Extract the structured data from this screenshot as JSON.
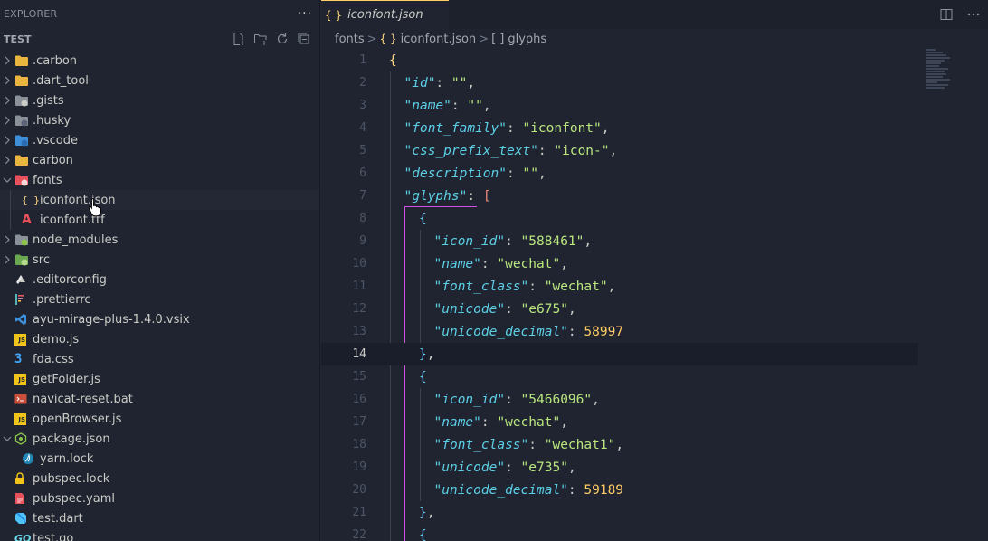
{
  "sidebar": {
    "title": "EXPLORER",
    "more": "···",
    "section": "TEST",
    "tree": [
      {
        "label": ".carbon",
        "icon": "folder-icon",
        "chevron": ">",
        "indent": 0
      },
      {
        "label": ".dart_tool",
        "icon": "folder-icon",
        "chevron": ">",
        "indent": 0
      },
      {
        "label": ".gists",
        "icon": "github-folder-icon",
        "chevron": ">",
        "indent": 0
      },
      {
        "label": ".husky",
        "icon": "husky-folder-icon",
        "chevron": ">",
        "indent": 0
      },
      {
        "label": ".vscode",
        "icon": "vscode-folder-icon",
        "chevron": ">",
        "indent": 0
      },
      {
        "label": "carbon",
        "icon": "folder-icon",
        "chevron": ">",
        "indent": 0
      },
      {
        "label": "fonts",
        "icon": "fonts-folder-icon",
        "chevron": "v",
        "indent": 0
      },
      {
        "label": "iconfont.json",
        "icon": "json-icon",
        "chevron": "",
        "indent": 1,
        "selected": true
      },
      {
        "label": "iconfont.ttf",
        "icon": "font-file-icon",
        "chevron": "",
        "indent": 1
      },
      {
        "label": "node_modules",
        "icon": "node-folder-icon",
        "chevron": ">",
        "indent": 0
      },
      {
        "label": "src",
        "icon": "src-folder-icon",
        "chevron": ">",
        "indent": 0
      },
      {
        "label": ".editorconfig",
        "icon": "editorconfig-icon",
        "chevron": "",
        "indent": 0
      },
      {
        "label": ".prettierrc",
        "icon": "prettier-icon",
        "chevron": "",
        "indent": 0
      },
      {
        "label": "ayu-mirage-plus-1.4.0.vsix",
        "icon": "vscode-icon",
        "chevron": "",
        "indent": 0
      },
      {
        "label": "demo.js",
        "icon": "js-icon",
        "chevron": "",
        "indent": 0
      },
      {
        "label": "fda.css",
        "icon": "css-icon",
        "chevron": "",
        "indent": 0
      },
      {
        "label": "getFolder.js",
        "icon": "js-icon",
        "chevron": "",
        "indent": 0
      },
      {
        "label": "navicat-reset.bat",
        "icon": "bat-icon",
        "chevron": "",
        "indent": 0
      },
      {
        "label": "openBrowser.js",
        "icon": "js-icon",
        "chevron": "",
        "indent": 0
      },
      {
        "label": "package.json",
        "icon": "node-json-icon",
        "chevron": "v",
        "indent": 0
      },
      {
        "label": "yarn.lock",
        "icon": "yarn-icon",
        "chevron": "",
        "indent": 1
      },
      {
        "label": "pubspec.lock",
        "icon": "lock-icon",
        "chevron": "",
        "indent": 0
      },
      {
        "label": "pubspec.yaml",
        "icon": "yaml-icon",
        "chevron": "",
        "indent": 0
      },
      {
        "label": "test.dart",
        "icon": "dart-icon",
        "chevron": "",
        "indent": 0
      },
      {
        "label": "test.go",
        "icon": "go-icon",
        "chevron": "",
        "indent": 0
      }
    ]
  },
  "tab": {
    "braces": "{ }",
    "label": "iconfont.json"
  },
  "breadcrumb": {
    "folder": "fonts",
    "sep": ">",
    "file_braces": "{ }",
    "file": "iconfont.json",
    "symbol_brackets": "[ ]",
    "symbol": "glyphs"
  },
  "editor": {
    "current_line": 14,
    "lines": [
      {
        "n": "1",
        "indent": 0,
        "tokens": [
          {
            "t": "{",
            "c": "b1"
          }
        ]
      },
      {
        "n": "2",
        "indent": 1,
        "tokens": [
          {
            "t": "\"id\"",
            "c": "key"
          },
          {
            "t": ": ",
            "c": "punc"
          },
          {
            "t": "\"\"",
            "c": "str"
          },
          {
            "t": ",",
            "c": "punc"
          }
        ]
      },
      {
        "n": "3",
        "indent": 1,
        "tokens": [
          {
            "t": "\"name\"",
            "c": "key"
          },
          {
            "t": ": ",
            "c": "punc"
          },
          {
            "t": "\"\"",
            "c": "str"
          },
          {
            "t": ",",
            "c": "punc"
          }
        ]
      },
      {
        "n": "4",
        "indent": 1,
        "tokens": [
          {
            "t": "\"font_family\"",
            "c": "key"
          },
          {
            "t": ": ",
            "c": "punc"
          },
          {
            "t": "\"iconfont\"",
            "c": "str"
          },
          {
            "t": ",",
            "c": "punc"
          }
        ]
      },
      {
        "n": "5",
        "indent": 1,
        "tokens": [
          {
            "t": "\"css_prefix_text\"",
            "c": "key"
          },
          {
            "t": ": ",
            "c": "punc"
          },
          {
            "t": "\"icon-\"",
            "c": "str"
          },
          {
            "t": ",",
            "c": "punc"
          }
        ]
      },
      {
        "n": "6",
        "indent": 1,
        "tokens": [
          {
            "t": "\"description\"",
            "c": "key"
          },
          {
            "t": ": ",
            "c": "punc"
          },
          {
            "t": "\"\"",
            "c": "str"
          },
          {
            "t": ",",
            "c": "punc"
          }
        ]
      },
      {
        "n": "7",
        "indent": 1,
        "tokens": [
          {
            "t": "\"glyphs\"",
            "c": "key"
          },
          {
            "t": ": ",
            "c": "punc"
          },
          {
            "t": "[",
            "c": "b2"
          }
        ]
      },
      {
        "n": "8",
        "indent": 2,
        "tokens": [
          {
            "t": "{",
            "c": "b3"
          }
        ]
      },
      {
        "n": "9",
        "indent": 3,
        "tokens": [
          {
            "t": "\"icon_id\"",
            "c": "key"
          },
          {
            "t": ": ",
            "c": "punc"
          },
          {
            "t": "\"588461\"",
            "c": "str"
          },
          {
            "t": ",",
            "c": "punc"
          }
        ]
      },
      {
        "n": "10",
        "indent": 3,
        "tokens": [
          {
            "t": "\"name\"",
            "c": "key"
          },
          {
            "t": ": ",
            "c": "punc"
          },
          {
            "t": "\"wechat\"",
            "c": "str"
          },
          {
            "t": ",",
            "c": "punc"
          }
        ]
      },
      {
        "n": "11",
        "indent": 3,
        "tokens": [
          {
            "t": "\"font_class\"",
            "c": "key"
          },
          {
            "t": ": ",
            "c": "punc"
          },
          {
            "t": "\"wechat\"",
            "c": "str"
          },
          {
            "t": ",",
            "c": "punc"
          }
        ]
      },
      {
        "n": "12",
        "indent": 3,
        "tokens": [
          {
            "t": "\"unicode\"",
            "c": "key"
          },
          {
            "t": ": ",
            "c": "punc"
          },
          {
            "t": "\"e675\"",
            "c": "str"
          },
          {
            "t": ",",
            "c": "punc"
          }
        ]
      },
      {
        "n": "13",
        "indent": 3,
        "tokens": [
          {
            "t": "\"unicode_decimal\"",
            "c": "key"
          },
          {
            "t": ": ",
            "c": "punc"
          },
          {
            "t": "58997",
            "c": "num"
          }
        ]
      },
      {
        "n": "14",
        "indent": 2,
        "tokens": [
          {
            "t": "}",
            "c": "b3"
          },
          {
            "t": ",",
            "c": "punc"
          }
        ]
      },
      {
        "n": "15",
        "indent": 2,
        "tokens": [
          {
            "t": "{",
            "c": "b3"
          }
        ]
      },
      {
        "n": "16",
        "indent": 3,
        "tokens": [
          {
            "t": "\"icon_id\"",
            "c": "key"
          },
          {
            "t": ": ",
            "c": "punc"
          },
          {
            "t": "\"5466096\"",
            "c": "str"
          },
          {
            "t": ",",
            "c": "punc"
          }
        ]
      },
      {
        "n": "17",
        "indent": 3,
        "tokens": [
          {
            "t": "\"name\"",
            "c": "key"
          },
          {
            "t": ": ",
            "c": "punc"
          },
          {
            "t": "\"wechat\"",
            "c": "str"
          },
          {
            "t": ",",
            "c": "punc"
          }
        ]
      },
      {
        "n": "18",
        "indent": 3,
        "tokens": [
          {
            "t": "\"font_class\"",
            "c": "key"
          },
          {
            "t": ": ",
            "c": "punc"
          },
          {
            "t": "\"wechat1\"",
            "c": "str"
          },
          {
            "t": ",",
            "c": "punc"
          }
        ]
      },
      {
        "n": "19",
        "indent": 3,
        "tokens": [
          {
            "t": "\"unicode\"",
            "c": "key"
          },
          {
            "t": ": ",
            "c": "punc"
          },
          {
            "t": "\"e735\"",
            "c": "str"
          },
          {
            "t": ",",
            "c": "punc"
          }
        ]
      },
      {
        "n": "20",
        "indent": 3,
        "tokens": [
          {
            "t": "\"unicode_decimal\"",
            "c": "key"
          },
          {
            "t": ": ",
            "c": "punc"
          },
          {
            "t": "59189",
            "c": "num"
          }
        ]
      },
      {
        "n": "21",
        "indent": 2,
        "tokens": [
          {
            "t": "}",
            "c": "b3"
          },
          {
            "t": ",",
            "c": "punc"
          }
        ]
      },
      {
        "n": "22",
        "indent": 2,
        "tokens": [
          {
            "t": "{",
            "c": "b3"
          }
        ]
      }
    ]
  },
  "colors": {
    "background": "#1f2430",
    "accent": "#ffcc66",
    "key": "#5ccfe6",
    "string": "#bae67e",
    "number": "#ffcc66",
    "bracket_guide": "#d450e8"
  }
}
